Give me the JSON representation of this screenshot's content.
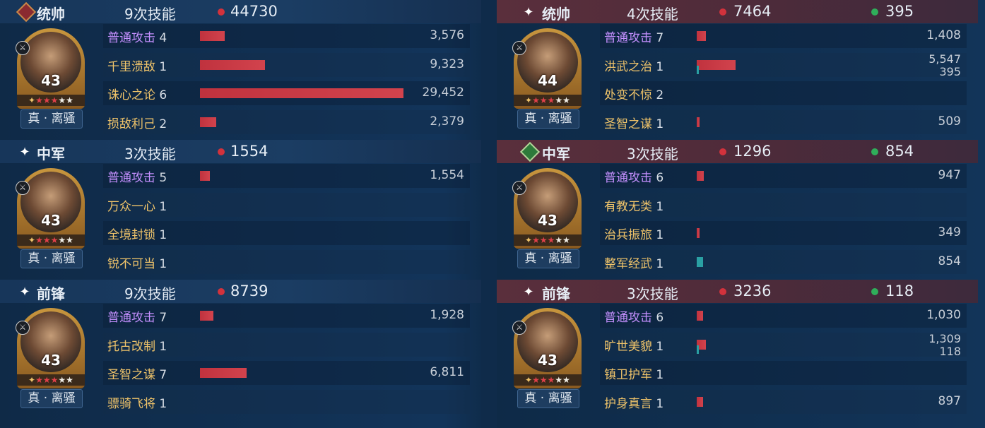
{
  "teams": {
    "left": [
      {
        "role": "统帅",
        "skills": "9次技能",
        "damage": "44730",
        "heal": null,
        "level": "43",
        "stars_red": 3,
        "stars_white": 2,
        "tag": "真 · 离骚",
        "rows": [
          {
            "name": "普通攻击",
            "count": "4",
            "color": "purple",
            "value": "3,576",
            "bar_pct": 0.12
          },
          {
            "name": "千里溃敌",
            "count": "1",
            "color": "gold",
            "value": "9,323",
            "bar_pct": 0.32
          },
          {
            "name": "诛心之论",
            "count": "6",
            "color": "gold",
            "value": "29,452",
            "bar_pct": 1.0
          },
          {
            "name": "损敌利己",
            "count": "2",
            "color": "gold",
            "value": "2,379",
            "bar_pct": 0.08
          }
        ]
      },
      {
        "role": "中军",
        "skills": "3次技能",
        "damage": "1554",
        "heal": null,
        "level": "43",
        "stars_red": 3,
        "stars_white": 2,
        "tag": "真 · 离骚",
        "rows": [
          {
            "name": "普通攻击",
            "count": "5",
            "color": "purple",
            "value": "1,554",
            "bar_pct": 0.05
          },
          {
            "name": "万众一心",
            "count": "1",
            "color": "gold",
            "value": "",
            "bar_pct": 0
          },
          {
            "name": "全境封锁",
            "count": "1",
            "color": "gold",
            "value": "",
            "bar_pct": 0
          },
          {
            "name": "锐不可当",
            "count": "1",
            "color": "gold",
            "value": "",
            "bar_pct": 0
          }
        ]
      },
      {
        "role": "前锋",
        "skills": "9次技能",
        "damage": "8739",
        "heal": null,
        "level": "43",
        "stars_red": 3,
        "stars_white": 2,
        "tag": "真 · 离骚",
        "rows": [
          {
            "name": "普通攻击",
            "count": "7",
            "color": "purple",
            "value": "1,928",
            "bar_pct": 0.065
          },
          {
            "name": "托古改制",
            "count": "1",
            "color": "gold",
            "value": "",
            "bar_pct": 0
          },
          {
            "name": "圣智之谋",
            "count": "7",
            "color": "gold",
            "value": "6,811",
            "bar_pct": 0.23
          },
          {
            "name": "骠骑飞将",
            "count": "1",
            "color": "gold",
            "value": "",
            "bar_pct": 0
          }
        ]
      }
    ],
    "right": [
      {
        "role": "统帅",
        "skills": "4次技能",
        "damage": "7464",
        "heal": "395",
        "level": "44",
        "stars_red": 3,
        "stars_white": 2,
        "tag": "真 · 离骚",
        "rows": [
          {
            "name": "普通攻击",
            "count": "7",
            "color": "purple",
            "value": "1,408",
            "bar_pct": 0.045
          },
          {
            "name": "洪武之治",
            "count": "1",
            "color": "gold",
            "value": "5,547",
            "value2": "395",
            "bar_pct": 0.19,
            "heal_bar": true
          },
          {
            "name": "处变不惊",
            "count": "2",
            "color": "gold",
            "value": "",
            "bar_pct": 0
          },
          {
            "name": "圣智之谋",
            "count": "1",
            "color": "gold",
            "value": "509",
            "bar_pct": 0.015
          }
        ]
      },
      {
        "role": "中军",
        "skills": "3次技能",
        "damage": "1296",
        "heal": "854",
        "level": "43",
        "stars_red": 3,
        "stars_white": 2,
        "tag": "真 · 离骚",
        "rows": [
          {
            "name": "普通攻击",
            "count": "6",
            "color": "purple",
            "value": "947",
            "bar_pct": 0.035
          },
          {
            "name": "有教无类",
            "count": "1",
            "color": "gold",
            "value": "",
            "bar_pct": 0
          },
          {
            "name": "治兵振旅",
            "count": "1",
            "color": "gold",
            "value": "349",
            "bar_pct": 0.01
          },
          {
            "name": "整军经武",
            "count": "1",
            "color": "gold",
            "value": "854",
            "bar_pct": 0.03,
            "teal": true
          }
        ]
      },
      {
        "role": "前锋",
        "skills": "3次技能",
        "damage": "3236",
        "heal": "118",
        "level": "43",
        "stars_red": 3,
        "stars_white": 2,
        "tag": "真 · 离骚",
        "rows": [
          {
            "name": "普通攻击",
            "count": "6",
            "color": "purple",
            "value": "1,030",
            "bar_pct": 0.03
          },
          {
            "name": "旷世美貌",
            "count": "1",
            "color": "gold",
            "value": "1,309",
            "value2": "118",
            "bar_pct": 0.045,
            "heal_bar": true
          },
          {
            "name": "镇卫护军",
            "count": "1",
            "color": "gold",
            "value": "",
            "bar_pct": 0
          },
          {
            "name": "护身真言",
            "count": "1",
            "color": "gold",
            "value": "897",
            "bar_pct": 0.03
          }
        ]
      }
    ]
  },
  "icons": {
    "role_left_first": "commander-badge-icon",
    "role_star": "sparkle-icon",
    "role_right_mid": "heal-badge-icon"
  }
}
